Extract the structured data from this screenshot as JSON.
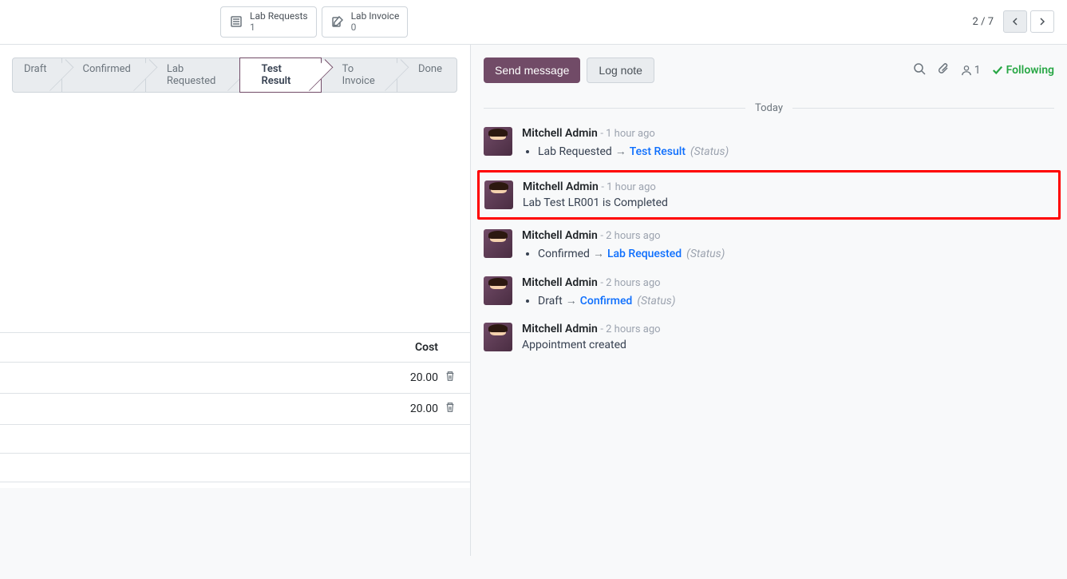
{
  "top": {
    "stats": [
      {
        "icon": "list",
        "label": "Lab Requests",
        "count": "1"
      },
      {
        "icon": "edit",
        "label": "Lab Invoice",
        "count": "0"
      }
    ],
    "pager": {
      "current": "2",
      "total": "7"
    }
  },
  "status_steps": [
    {
      "label": "Draft",
      "active": false
    },
    {
      "label": "Confirmed",
      "active": false
    },
    {
      "label": "Lab Requested",
      "active": false
    },
    {
      "label": "Test Result",
      "active": true
    },
    {
      "label": "To Invoice",
      "active": false
    },
    {
      "label": "Done",
      "active": false
    }
  ],
  "chatter": {
    "send_label": "Send message",
    "log_label": "Log note",
    "followers_count": "1",
    "following_label": "Following",
    "date_header": "Today",
    "messages": [
      {
        "author": "Mitchell Admin",
        "time": "- 1 hour ago",
        "type": "status",
        "from": "Lab Requested",
        "to": "Test Result",
        "field": "(Status)",
        "highlighted": false
      },
      {
        "author": "Mitchell Admin",
        "time": "- 1 hour ago",
        "type": "text",
        "text": "Lab Test LR001 is Completed",
        "highlighted": true
      },
      {
        "author": "Mitchell Admin",
        "time": "- 2 hours ago",
        "type": "status",
        "from": "Confirmed",
        "to": "Lab Requested",
        "field": "(Status)",
        "highlighted": false
      },
      {
        "author": "Mitchell Admin",
        "time": "- 2 hours ago",
        "type": "status",
        "from": "Draft",
        "to": "Confirmed",
        "field": "(Status)",
        "highlighted": false
      },
      {
        "author": "Mitchell Admin",
        "time": "- 2 hours ago",
        "type": "text",
        "text": "Appointment created",
        "highlighted": false
      }
    ]
  },
  "table": {
    "column": "Cost",
    "rows": [
      {
        "cost": "20.00"
      },
      {
        "cost": "20.00"
      }
    ]
  }
}
